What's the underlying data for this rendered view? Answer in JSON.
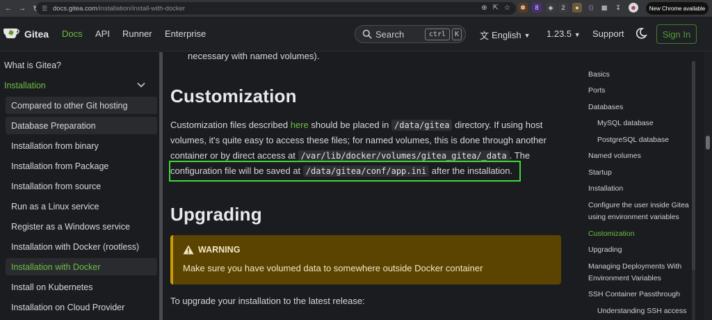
{
  "browser": {
    "url_host": "docs.gitea.com",
    "url_path": "/installation/install-with-docker",
    "new_chrome_label": "New Chrome available",
    "ext_badge_1": "8",
    "ext_badge_2": "2"
  },
  "header": {
    "brand": "Gitea",
    "nav": [
      "Docs",
      "API",
      "Runner",
      "Enterprise"
    ],
    "search_label": "Search",
    "search_kbd_1": "ctrl",
    "search_kbd_2": "K",
    "language": "English",
    "version": "1.23.5",
    "support": "Support",
    "sign_in": "Sign In"
  },
  "sidebar": {
    "items": [
      "What is Gitea?",
      "Installation",
      "Compared to other Git hosting",
      "Database Preparation",
      "Installation from binary",
      "Installation from Package",
      "Installation from source",
      "Run as a Linux service",
      "Register as a Windows service",
      "Installation with Docker (rootless)",
      "Installation with Docker",
      "Install on Kubernetes",
      "Installation on Cloud Provider"
    ]
  },
  "content": {
    "prev_text": "necessary with named volumes).",
    "h_customization": "Customization",
    "c1_a": "Customization files described ",
    "c1_link": "here",
    "c1_b": " should be placed in ",
    "c1_code1": "/data/gitea",
    "c1_c": " directory. If using host volumes, it's quite easy to access these files; for named volumes, this is done through another container or by direct access at ",
    "c1_code2": "/var/lib/docker/volumes/gitea_gitea/_data",
    "c1_d": ". The configuration file will be saved at ",
    "c1_code3": "/data/gitea/conf/app.ini",
    "c1_e": " after the installation.",
    "h_upgrading": "Upgrading",
    "warning_title": "WARNING",
    "warning_text": "Make sure you have volumed data to somewhere outside Docker container",
    "upgrade_text": "To upgrade your installation to the latest release:"
  },
  "toc": {
    "items": [
      "Basics",
      "Ports",
      "Databases",
      "MySQL database",
      "PostgreSQL database",
      "Named volumes",
      "Startup",
      "Installation",
      "Configure the user inside Gitea",
      "using environment variables",
      "Customization",
      "Upgrading",
      "Managing Deployments With",
      "Environment Variables",
      "SSH Container Passthrough",
      "Understanding SSH access"
    ]
  },
  "colors": {
    "accent": "#6cbf43",
    "highlight_box": "#3fd73a",
    "warning_bg": "#5b4401",
    "warning_border": "#cc9a06"
  }
}
